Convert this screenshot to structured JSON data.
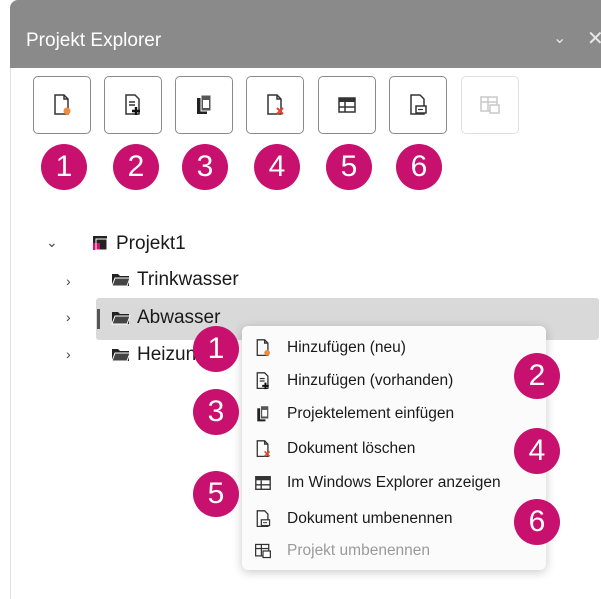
{
  "panel": {
    "title": "Projekt Explorer",
    "chevron": "⌄",
    "close": "✕"
  },
  "toolbar": {
    "buttons": [
      {
        "icon": "new-document-icon",
        "enabled": true
      },
      {
        "icon": "add-existing-icon",
        "enabled": true
      },
      {
        "icon": "paste-element-icon",
        "enabled": true
      },
      {
        "icon": "delete-document-icon",
        "enabled": true
      },
      {
        "icon": "windows-explorer-icon",
        "enabled": true
      },
      {
        "icon": "rename-document-icon",
        "enabled": true
      },
      {
        "icon": "rename-project-icon",
        "enabled": false
      }
    ],
    "badges": [
      "1",
      "2",
      "3",
      "4",
      "5",
      "6"
    ]
  },
  "tree": {
    "project": "Projekt1",
    "items": [
      "Trinkwasser",
      "Abwasser",
      "Heizung"
    ],
    "selected_index": 1
  },
  "context_menu": {
    "items": [
      {
        "label": "Hinzufügen (neu)",
        "icon": "new-document-icon",
        "enabled": true
      },
      {
        "label": "Hinzufügen (vorhanden)",
        "icon": "add-existing-icon",
        "enabled": true
      },
      {
        "label": "Projektelement einfügen",
        "icon": "paste-element-icon",
        "enabled": true
      },
      {
        "label": "Dokument löschen",
        "icon": "delete-document-icon",
        "enabled": true
      },
      {
        "label": "Im Windows Explorer anzeigen",
        "icon": "windows-explorer-icon",
        "enabled": true
      },
      {
        "label": "Dokument umbenennen",
        "icon": "rename-document-icon",
        "enabled": true
      },
      {
        "label": "Projekt umbenennen",
        "icon": "rename-project-icon",
        "enabled": false
      }
    ],
    "badges": [
      "1",
      "2",
      "3",
      "4",
      "5",
      "6"
    ]
  },
  "colors": {
    "badge": "#c8106e",
    "title_bar": "#8a8a8a",
    "accent_orange": "#f08a3c",
    "delete_red": "#e0442c",
    "project_pink": "#d0106e"
  }
}
